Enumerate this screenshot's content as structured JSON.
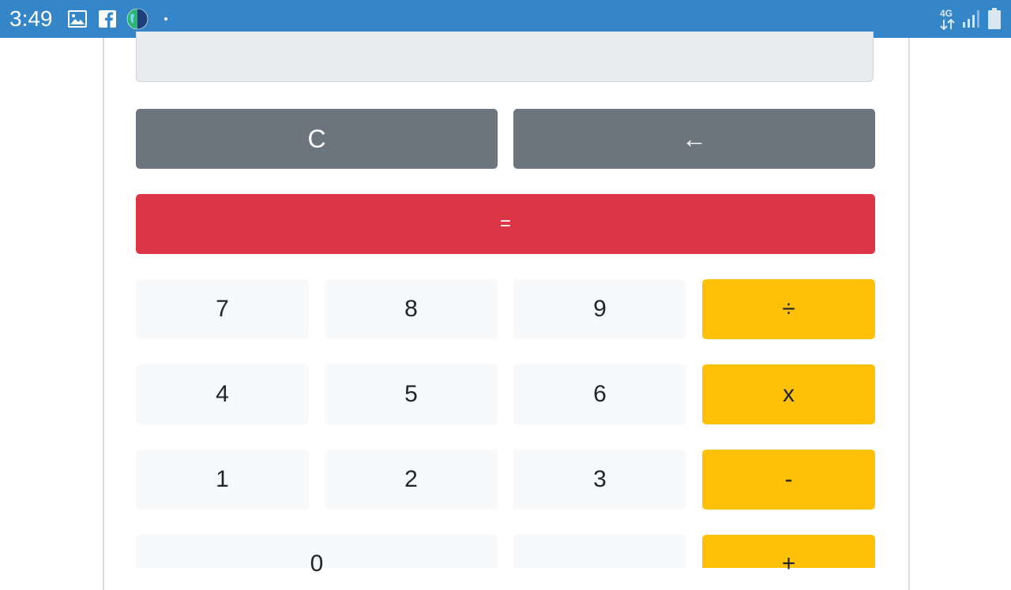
{
  "status_bar": {
    "time": "3:49",
    "network_label": "4G",
    "background": "#3586c9",
    "icons": [
      "gallery-icon",
      "facebook-icon",
      "globe-icon",
      "notification-dot-icon",
      "network-arrows-icon",
      "signal-icon",
      "battery-icon"
    ]
  },
  "calculator": {
    "display_value": "",
    "clear_label": "C",
    "backspace_label": "←",
    "equals_label": "=",
    "rows": [
      [
        {
          "label": "7",
          "kind": "digit"
        },
        {
          "label": "8",
          "kind": "digit"
        },
        {
          "label": "9",
          "kind": "digit"
        },
        {
          "label": "÷",
          "kind": "operator"
        }
      ],
      [
        {
          "label": "4",
          "kind": "digit"
        },
        {
          "label": "5",
          "kind": "digit"
        },
        {
          "label": "6",
          "kind": "digit"
        },
        {
          "label": "x",
          "kind": "operator"
        }
      ],
      [
        {
          "label": "1",
          "kind": "digit"
        },
        {
          "label": "2",
          "kind": "digit"
        },
        {
          "label": "3",
          "kind": "digit"
        },
        {
          "label": "-",
          "kind": "operator"
        }
      ],
      [
        {
          "label": "0",
          "kind": "digit"
        },
        {
          "label": "",
          "kind": "digit"
        },
        {
          "label": "+",
          "kind": "operator"
        }
      ]
    ],
    "colors": {
      "gray": "#6c757d",
      "red": "#dc3545",
      "light": "#f8f9fa",
      "yellow": "#ffc107",
      "display": "#e9ecef"
    }
  }
}
